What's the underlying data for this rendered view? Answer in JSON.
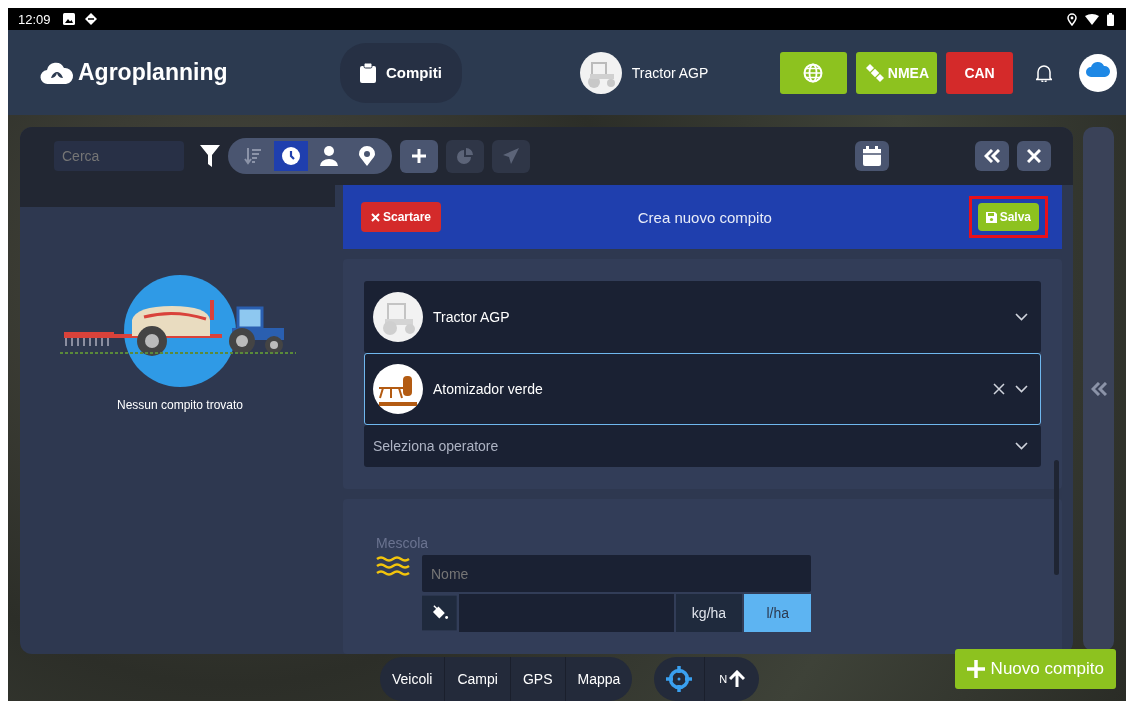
{
  "status_bar": {
    "time": "12:09"
  },
  "header": {
    "app_name": "Agroplanning",
    "nav_tab": {
      "label": "Compiti",
      "selected": true
    },
    "vehicle": {
      "name": "Tractor AGP"
    },
    "buttons": [
      {
        "kind": "globe"
      },
      {
        "kind": "nmea",
        "label": "NMEA"
      },
      {
        "kind": "can",
        "label": "CAN"
      }
    ]
  },
  "toolbar": {
    "search": {
      "placeholder": "Cerca"
    },
    "sort_modes": [
      {
        "kind": "sort",
        "selected": false
      },
      {
        "kind": "clock",
        "selected": true
      },
      {
        "kind": "person",
        "selected": false
      },
      {
        "kind": "pin",
        "selected": false
      }
    ],
    "actions": [
      {
        "kind": "add",
        "disabled": false
      },
      {
        "kind": "chart",
        "disabled": true
      },
      {
        "kind": "send",
        "disabled": true
      }
    ]
  },
  "empty_state": {
    "message": "Nessun compito trovato"
  },
  "form": {
    "title": "Crea nuovo compito",
    "discard_label": "Scartare",
    "save_label": "Salva",
    "selects": [
      {
        "kind": "tractor",
        "value": "Tractor AGP",
        "focused": false,
        "clearable": false
      },
      {
        "kind": "sprayer",
        "value": "Atomizador verde",
        "focused": true,
        "clearable": true
      },
      {
        "kind": "plain",
        "placeholder": "Seleziona operatore",
        "focused": false,
        "clearable": false
      }
    ],
    "mix": {
      "label": "Mescola",
      "name_placeholder": "Nome",
      "units": [
        {
          "label": "kg/ha",
          "selected": false
        },
        {
          "label": "l/ha",
          "selected": true
        }
      ]
    }
  },
  "bottom_nav": {
    "tabs": [
      {
        "label": "Veicoli"
      },
      {
        "label": "Campi"
      },
      {
        "label": "GPS"
      },
      {
        "label": "Mappa"
      }
    ],
    "compass_label": "N"
  },
  "new_task_button": {
    "label": "Nuovo compito"
  }
}
